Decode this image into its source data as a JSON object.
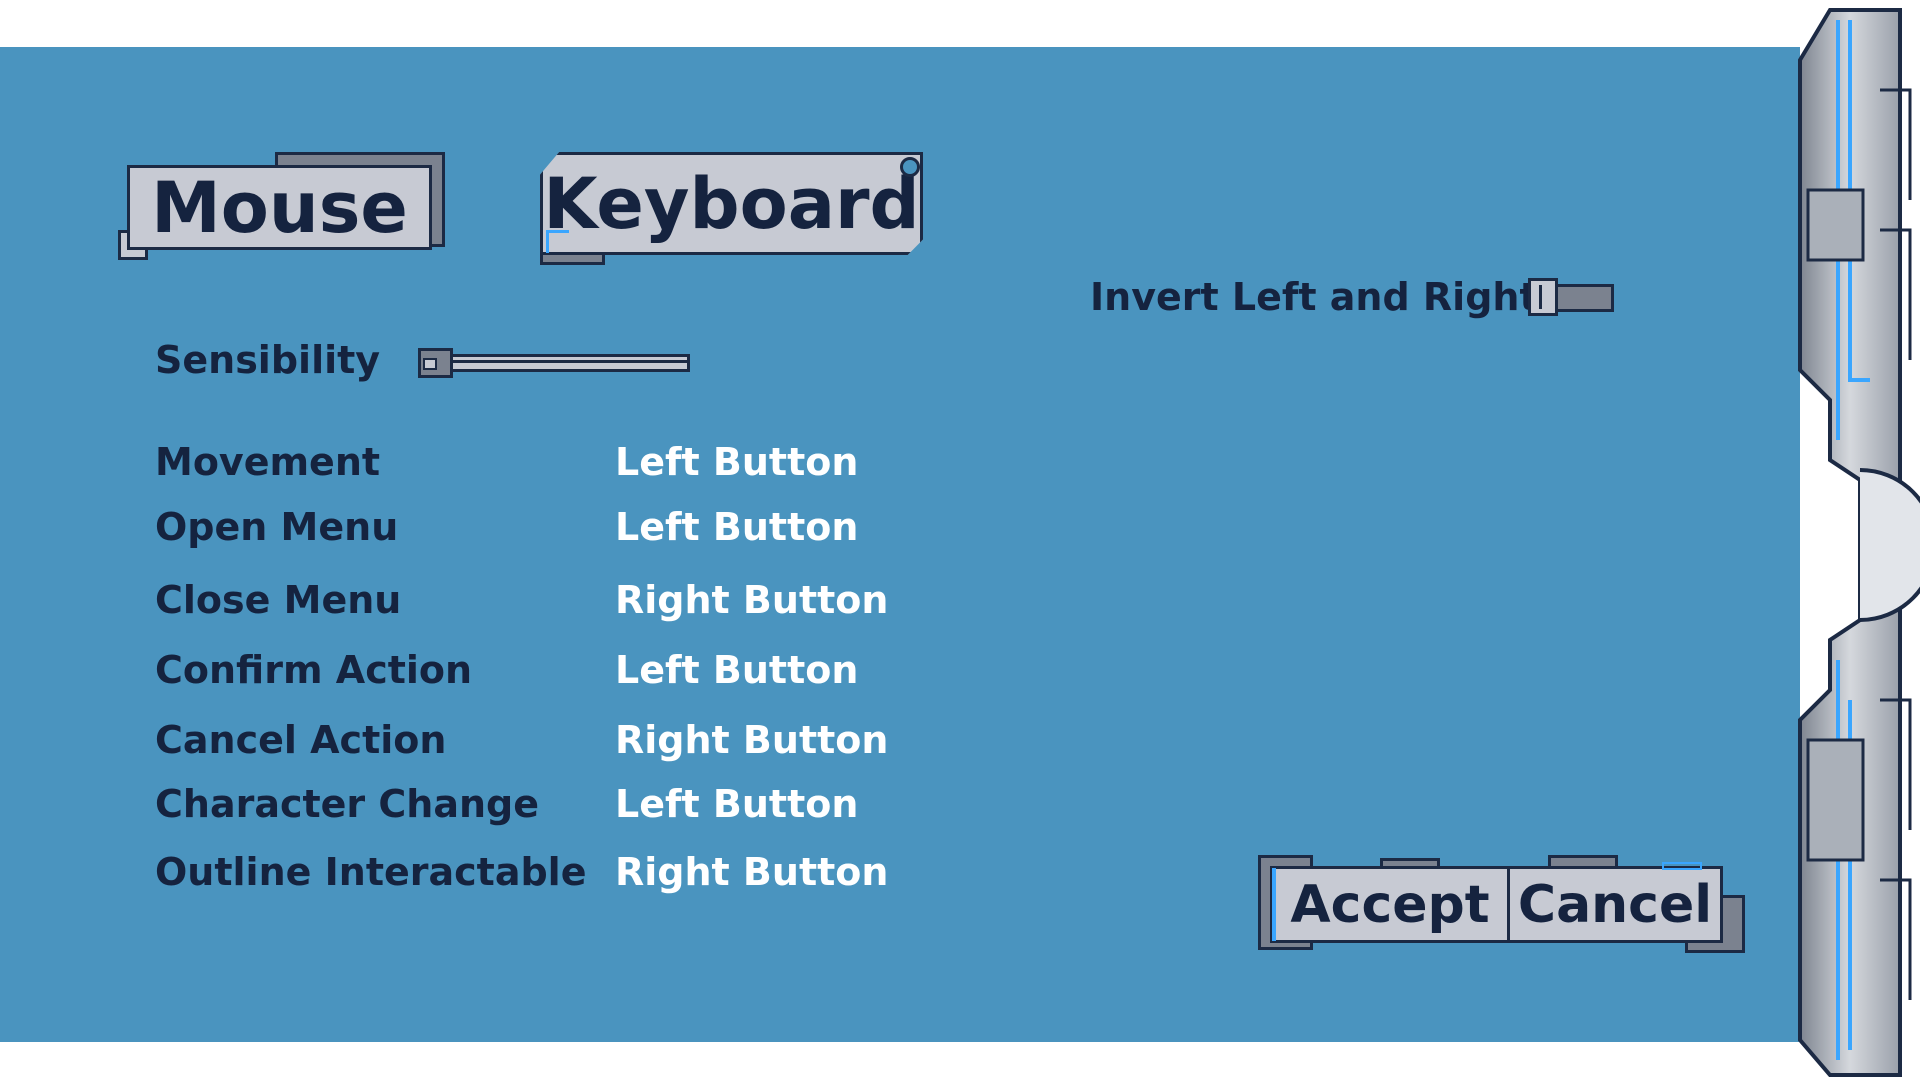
{
  "tabs": {
    "mouse": "Mouse",
    "keyboard": "Keyboard"
  },
  "settings": {
    "sensibility_label": "Sensibility",
    "sensibility_value": 0.05,
    "invert_label": "Invert Left and Right",
    "invert_on": false
  },
  "bindings": [
    {
      "action": "Movement",
      "key": "Left Button"
    },
    {
      "action": "Open Menu",
      "key": "Left Button"
    },
    {
      "action": "Close Menu",
      "key": "Right Button"
    },
    {
      "action": "Confirm Action",
      "key": "Left Button"
    },
    {
      "action": "Cancel Action",
      "key": "Right Button"
    },
    {
      "action": "Character Change",
      "key": "Left Button"
    },
    {
      "action": "Outline Interactable",
      "key": "Right Button"
    }
  ],
  "buttons": {
    "accept": "Accept",
    "cancel": "Cancel"
  },
  "colors": {
    "panel": "#4a94bf",
    "text_dark": "#15233f",
    "text_light": "#ffffff",
    "metal": "#c7cad3",
    "accent": "#3aa6ff"
  }
}
